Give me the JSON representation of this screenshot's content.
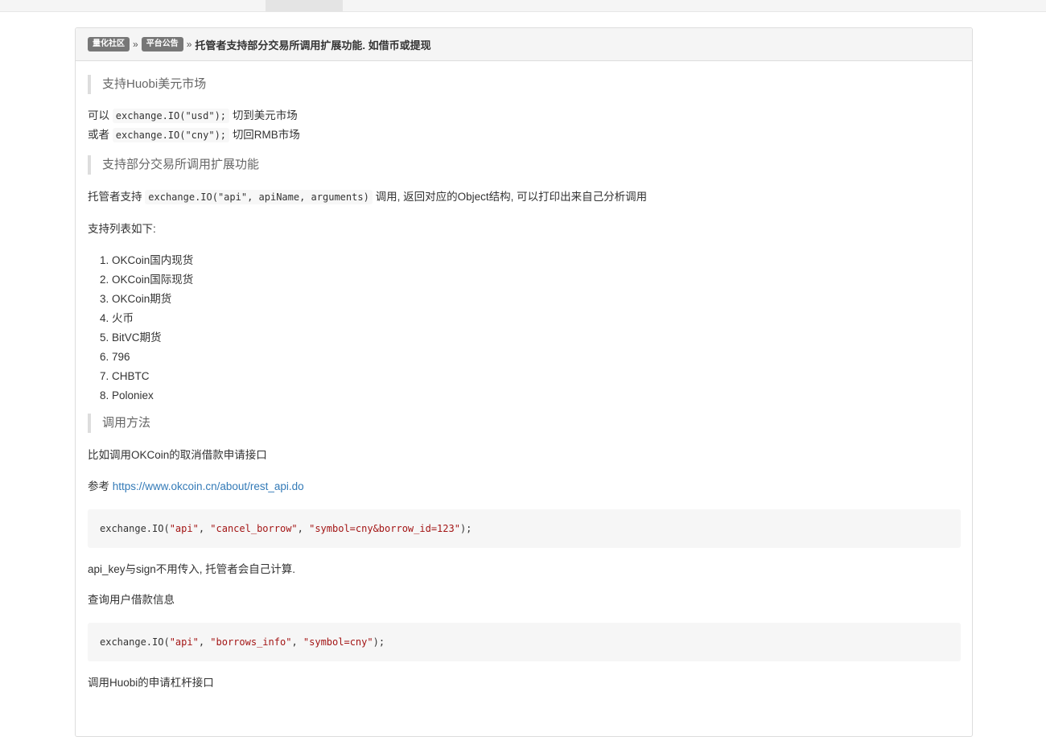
{
  "breadcrumb": {
    "community_label": "量化社区",
    "announcement_label": "平台公告",
    "separator": "»",
    "title": "托管者支持部分交易所调用扩展功能. 如借币或提现"
  },
  "section_usd": {
    "heading": "支持Huobi美元市场",
    "line1_prefix": "可以",
    "line1_code": "exchange.IO(\"usd\");",
    "line1_suffix": "切到美元市场",
    "line2_prefix": "或者",
    "line2_code": "exchange.IO(\"cny\");",
    "line2_suffix": "切回RMB市场"
  },
  "section_ext": {
    "heading": "支持部分交易所调用扩展功能",
    "intro_prefix": "托管者支持",
    "intro_code": "exchange.IO(\"api\", apiName, arguments)",
    "intro_suffix": "调用, 返回对应的Object结构, 可以打印出来自己分析调用",
    "list_intro": "支持列表如下:",
    "exchanges": [
      "OKCoin国内现货",
      "OKCoin国际现货",
      "OKCoin期货",
      "火币",
      "BitVC期货",
      "796",
      "CHBTC",
      "Poloniex"
    ]
  },
  "section_usage": {
    "heading": "调用方法",
    "example_intro": "比如调用OKCoin的取消借款申请接口",
    "reference_prefix": "参考",
    "reference_url": "https://www.okcoin.cn/about/rest_api.do",
    "code1": {
      "fn": "exchange.IO(",
      "arg1": "\"api\"",
      "arg2": "\"cancel_borrow\"",
      "arg3": "\"symbol=cny&borrow_id=123\"",
      "end": ");"
    },
    "note": "api_key与sign不用传入, 托管者会自己计算.",
    "query_intro": "查询用户借款信息",
    "code2": {
      "fn": "exchange.IO(",
      "arg1": "\"api\"",
      "arg2": "\"borrows_info\"",
      "arg3": "\"symbol=cny\"",
      "end": ");"
    },
    "huobi_intro": "调用Huobi的申请杠杆接口"
  },
  "colors": {
    "label_bg": "#777777",
    "link": "#337ab7",
    "string": "#a31515"
  }
}
